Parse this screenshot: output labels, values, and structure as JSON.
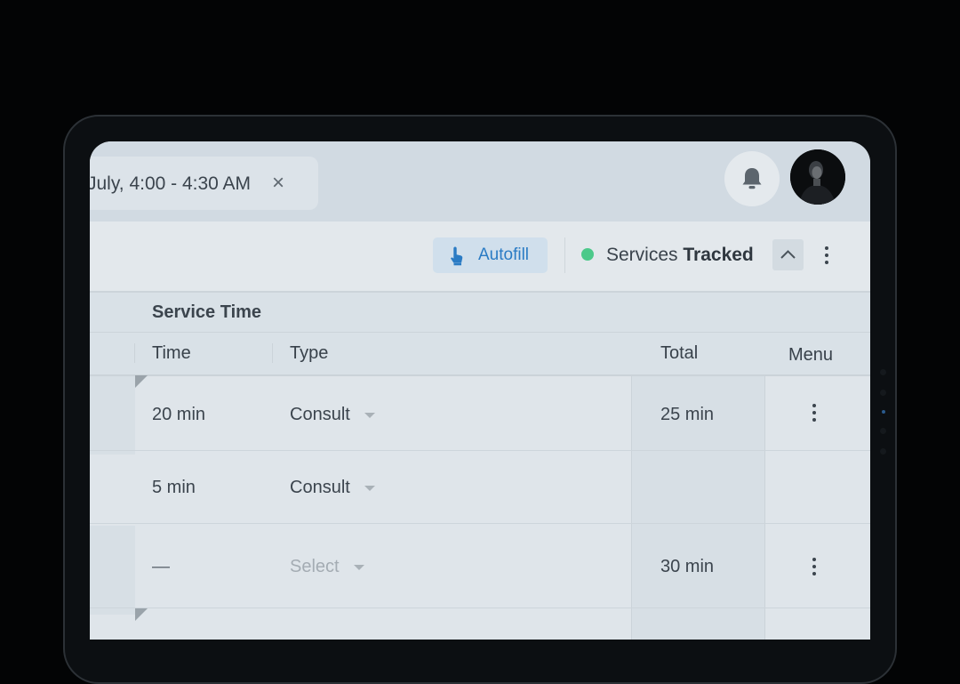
{
  "header": {
    "event_chip": {
      "label": "July, 4:00 - 4:30 AM",
      "close_symbol": "×"
    },
    "icons": {
      "bell": "bell-icon",
      "avatar": "user-avatar"
    }
  },
  "toolbar": {
    "autofill_label": "Autofill",
    "status": {
      "word1": "Services",
      "word2": "Tracked",
      "color": "#4cc98a"
    },
    "accent": "#2a7bc4"
  },
  "table": {
    "group_label": "Service Time",
    "columns": {
      "time": "Time",
      "type": "Type",
      "total": "Total",
      "menu": "Menu"
    },
    "rows": [
      {
        "time": "20 min",
        "type": "Consult",
        "total": "25 min"
      },
      {
        "time": "5 min",
        "type": "Consult",
        "total": ""
      },
      {
        "time": "—",
        "type": "Select",
        "total": "30 min"
      }
    ]
  }
}
